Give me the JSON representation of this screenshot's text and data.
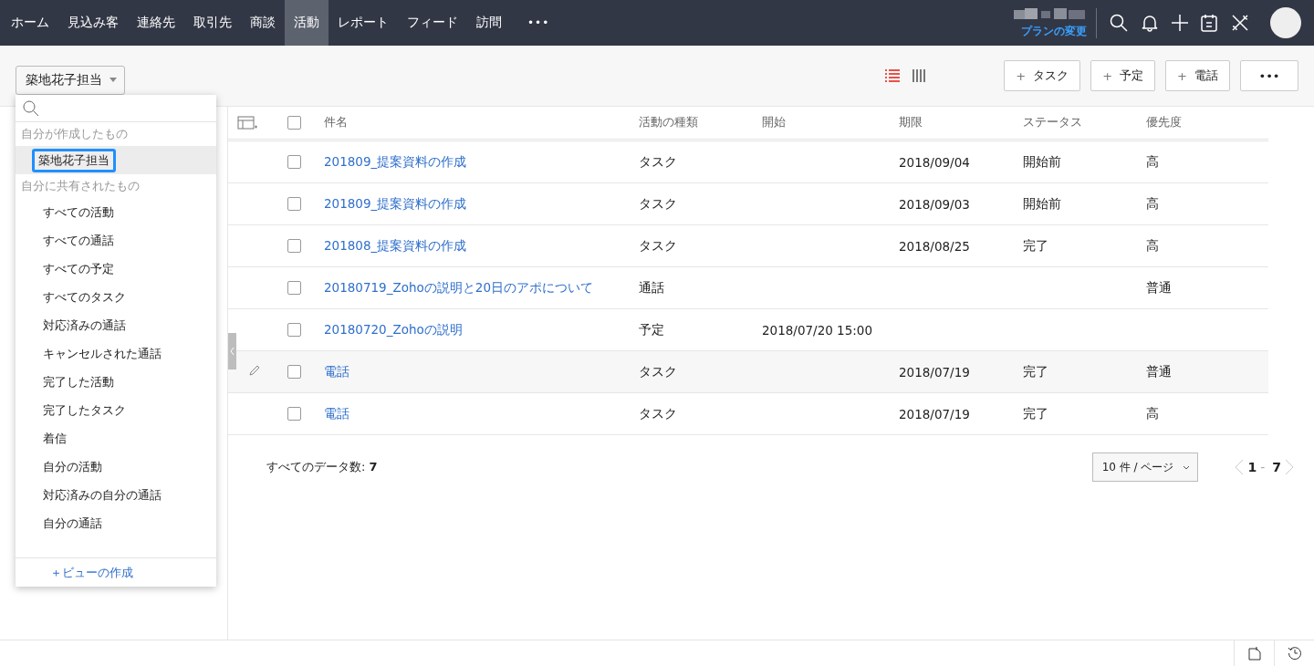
{
  "nav": {
    "tabs": [
      {
        "label": "ホーム",
        "selected": false
      },
      {
        "label": "見込み客",
        "selected": false
      },
      {
        "label": "連絡先",
        "selected": false
      },
      {
        "label": "取引先",
        "selected": false
      },
      {
        "label": "商談",
        "selected": false
      },
      {
        "label": "活動",
        "selected": true
      },
      {
        "label": "レポート",
        "selected": false
      },
      {
        "label": "フィード",
        "selected": false
      },
      {
        "label": "訪問",
        "selected": false
      }
    ],
    "more": "•••",
    "plan_link": "プランの変更"
  },
  "toolbar": {
    "view_select": "築地花子担当",
    "view_modes": [
      {
        "kind": "list",
        "selected": true
      },
      {
        "kind": "columns",
        "selected": false
      }
    ],
    "buttons": [
      {
        "icon": "+",
        "label": "タスク"
      },
      {
        "icon": "+",
        "label": "予定"
      },
      {
        "icon": "+",
        "label": "電話"
      },
      {
        "label": "•••"
      }
    ]
  },
  "view_menu": {
    "sections": [
      {
        "heading": "自分が作成したもの",
        "items": [
          {
            "label": "築地花子担当",
            "selected": true
          }
        ]
      },
      {
        "heading": "自分に共有されたもの",
        "items": [
          {
            "label": "すべての活動",
            "selected": false
          },
          {
            "label": "すべての通話",
            "selected": false
          },
          {
            "label": "すべての予定",
            "selected": false
          },
          {
            "label": "すべてのタスク",
            "selected": false
          },
          {
            "label": "対応済みの通話",
            "selected": false
          },
          {
            "label": "キャンセルされた通話",
            "selected": false
          },
          {
            "label": "完了した活動",
            "selected": false
          },
          {
            "label": "完了したタスク",
            "selected": false
          },
          {
            "label": "着信",
            "selected": false
          },
          {
            "label": "自分の活動",
            "selected": false
          },
          {
            "label": "対応済みの自分の通話",
            "selected": false
          },
          {
            "label": "自分の通話",
            "selected": false
          }
        ]
      }
    ],
    "create_link": "＋ビューの作成"
  },
  "table": {
    "select_all_checked": false,
    "columns": [
      "件名",
      "活動の種類",
      "開始",
      "期限",
      "ステータス",
      "優先度"
    ],
    "rows": [
      {
        "checked": false,
        "hovered": false,
        "cells": [
          "201809_提案資料の作成",
          "タスク",
          "",
          "2018/09/04",
          "開始前",
          "高"
        ]
      },
      {
        "checked": false,
        "hovered": false,
        "cells": [
          "201809_提案資料の作成",
          "タスク",
          "",
          "2018/09/03",
          "開始前",
          "高"
        ]
      },
      {
        "checked": false,
        "hovered": false,
        "cells": [
          "201808_提案資料の作成",
          "タスク",
          "",
          "2018/08/25",
          "完了",
          "高"
        ]
      },
      {
        "checked": false,
        "hovered": false,
        "cells": [
          "20180719_Zohoの説明と20日のアポについて",
          "通話",
          "",
          "",
          "",
          "普通"
        ]
      },
      {
        "checked": false,
        "hovered": false,
        "cells": [
          "20180720_Zohoの説明",
          "予定",
          "2018/07/20 15:00",
          "",
          "",
          ""
        ]
      },
      {
        "checked": false,
        "hovered": true,
        "cells": [
          "電話",
          "タスク",
          "",
          "2018/07/19",
          "完了",
          "普通"
        ]
      },
      {
        "checked": false,
        "hovered": false,
        "cells": [
          "電話",
          "タスク",
          "",
          "2018/07/19",
          "完了",
          "高"
        ]
      }
    ]
  },
  "footer": {
    "total_label": "すべてのデータ数:",
    "total": "7",
    "per_page": "10 件 / ページ",
    "range_start": "1",
    "range_sep": "-",
    "range_end": "7"
  }
}
